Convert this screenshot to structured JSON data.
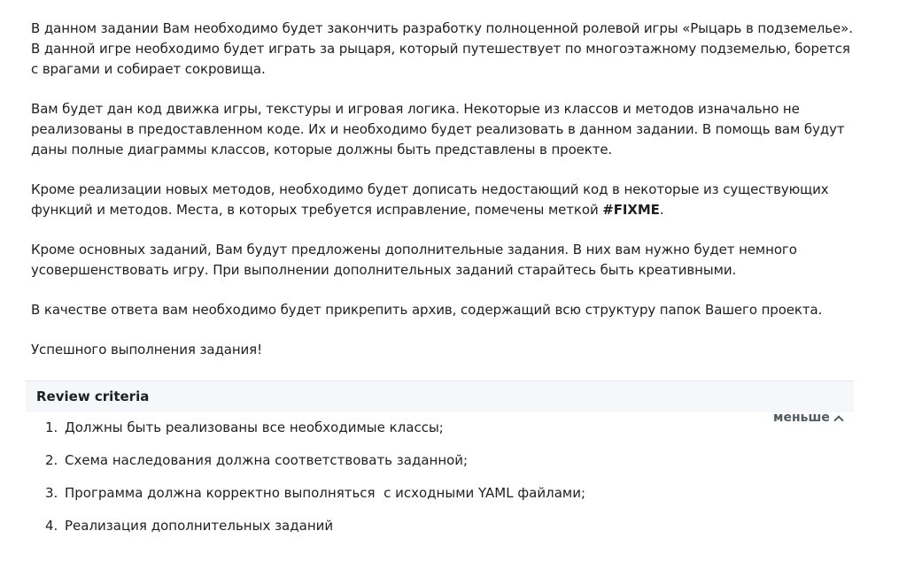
{
  "description": {
    "p1": "В данном задании Вам необходимо будет закончить разработку полноценной ролевой игры «Рыцарь в подземелье». В данной игре необходимо будет играть за рыцаря, который путешествует по многоэтажному подземелью, борется с врагами и собирает сокровища.",
    "p2": "Вам будет дан код движка игры, текстуры и игровая логика. Некоторые из классов и методов изначально не реализованы в предоставленном коде. Их и необходимо будет реализовать в данном задании. В помощь вам будут даны полные диаграммы классов, которые должны быть представлены в проекте.",
    "p3_before": "Кроме реализации новых методов, необходимо будет дописать недостающий код в некоторые из существующих функций и методов. Места, в которых требуется исправление, помечены меткой ",
    "p3_tag": "#FIXME",
    "p3_after": ".",
    "p4": "Кроме основных заданий, Вам будут предложены дополнительные задания. В них вам нужно будет немного усовершенствовать игру. При выполнении дополнительных заданий старайтесь быть креативными.",
    "p5": "В качестве ответа вам необходимо будет прикрепить архив, содержащий всю структуру папок Вашего проекта.",
    "p6": "Успешного выполнения задания!"
  },
  "review": {
    "title": "Review criteria",
    "toggle_label": "меньше",
    "toggle_icon": "chevron-up-icon",
    "criteria": [
      {
        "num": "1.",
        "text": "Должны быть реализованы все необходимые классы;"
      },
      {
        "num": "2.",
        "text": "Схема наследования должна соответствовать заданной;"
      },
      {
        "num": "3.",
        "text": "Программа должна корректно выполняться  с исходными YAML файлами;"
      },
      {
        "num": "4.",
        "text": "Реализация дополнительных заданий"
      }
    ]
  },
  "colors": {
    "text": "#1f1f1f",
    "header_bg": "#f5f7fa",
    "toggle": "#555a60"
  }
}
